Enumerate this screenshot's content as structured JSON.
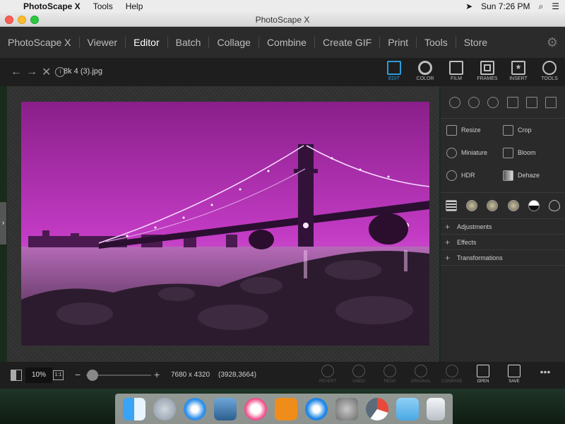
{
  "menubar": {
    "app_name": "PhotoScape X",
    "items": [
      "Tools",
      "Help"
    ],
    "clock": "Sun 7:26 PM"
  },
  "window": {
    "title": "PhotoScape X"
  },
  "nav": {
    "items": [
      "PhotoScape X",
      "Viewer",
      "Editor",
      "Batch",
      "Collage",
      "Combine",
      "Create GIF",
      "Print",
      "Tools",
      "Store"
    ],
    "active": "Editor"
  },
  "editor": {
    "filename": "8k 4 (3).jpg",
    "modes": [
      "EDIT",
      "COLOR",
      "FILM",
      "FRAMES",
      "INSERT",
      "TOOLS"
    ],
    "active_mode": "EDIT",
    "accent": "#2d9cdb"
  },
  "panel": {
    "tools": [
      "Resize",
      "Crop",
      "Miniature",
      "Bloom",
      "HDR",
      "Dehaze"
    ],
    "sections": [
      "Adjustments",
      "Effects",
      "Transformations"
    ]
  },
  "status": {
    "zoom": "10%",
    "one_to_one": "1:1",
    "dimensions": "7680 x 4320",
    "coords": "(3928,3664)",
    "zoom_level": 0.1,
    "actions": [
      "REVERT",
      "UNDO",
      "REDO",
      "ORIGINAL",
      "COMPARE",
      "OPEN",
      "SAVE"
    ],
    "more": "•••"
  }
}
